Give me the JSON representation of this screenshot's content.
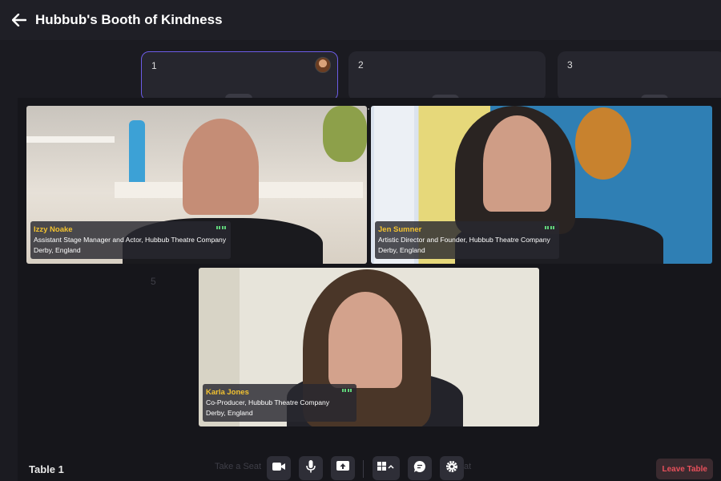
{
  "header": {
    "title": "Hubbub's Booth of Kindness"
  },
  "tables": [
    {
      "number": "1"
    },
    {
      "number": "2"
    },
    {
      "number": "3"
    }
  ],
  "hidden_table_number": "5",
  "participants": [
    {
      "name": "Izzy Noake",
      "role": "Assistant Stage Manager and Actor, Hubbub Theatre Company",
      "location": "Derby, England"
    },
    {
      "name": "Jen Sumner",
      "role": "Artistic Director and Founder, Hubbub Theatre Company",
      "location": "Derby, England"
    },
    {
      "name": "Karla Jones",
      "role": "Co-Producer, Hubbub Theatre Company",
      "location": "Derby, England"
    }
  ],
  "toolbar": {
    "table_label": "Table 1",
    "faint_left": "Take a Seat",
    "faint_right": "at",
    "leave_label": "Leave Table",
    "buttons": [
      "camera-icon",
      "microphone-icon",
      "share-screen-icon",
      "layout-grid-icon",
      "chat-icon",
      "settings-icon"
    ]
  },
  "colors": {
    "accent": "#6c5ce7",
    "name": "#f2c230",
    "leave": "#e8505b",
    "audio": "#5fd37a"
  }
}
